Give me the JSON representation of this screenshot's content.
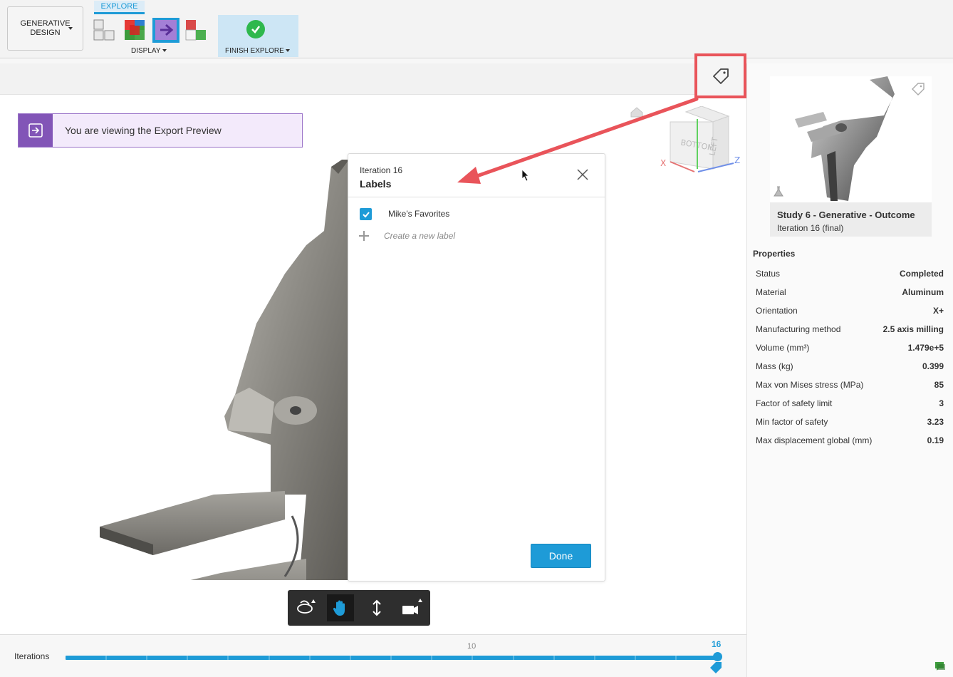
{
  "toolbar": {
    "workspace_label": "GENERATIVE DESIGN",
    "active_tab": "EXPLORE",
    "display_label": "DISPLAY",
    "finish_label": "FINISH EXPLORE",
    "icons": [
      "display-grid-icon",
      "display-heatmap-icon",
      "export-preview-icon",
      "compare-icon"
    ]
  },
  "banner": {
    "text": "You are viewing the Export Preview"
  },
  "viewcube": {
    "faces": [
      "BOTTOM",
      "LEFT"
    ],
    "axes": [
      "X",
      "Z"
    ]
  },
  "dialog": {
    "subtitle": "Iteration 16",
    "title": "Labels",
    "labels": [
      {
        "name": "Mike's Favorites",
        "checked": true
      }
    ],
    "new_label_placeholder": "Create a new label",
    "done_label": "Done"
  },
  "iterations": {
    "label": "Iterations",
    "tick_label": "10",
    "current": "16",
    "accent": "#1e9bd7"
  },
  "panel": {
    "card_title": "Study 6 - Generative - Outcome",
    "card_sub": "Iteration 16 (final)",
    "properties_title": "Properties",
    "properties": [
      {
        "name": "Status",
        "value": "Completed"
      },
      {
        "name": "Material",
        "value": "Aluminum"
      },
      {
        "name": "Orientation",
        "value": "X+"
      },
      {
        "name": "Manufacturing method",
        "value": "2.5 axis milling"
      },
      {
        "name": "Volume (mm³)",
        "value": "1.479e+5"
      },
      {
        "name": "Mass (kg)",
        "value": "0.399"
      },
      {
        "name": "Max von Mises stress (MPa)",
        "value": "85"
      },
      {
        "name": "Factor of safety limit",
        "value": "3"
      },
      {
        "name": "Min factor of safety",
        "value": "3.23"
      },
      {
        "name": "Max displacement global (mm)",
        "value": "0.19"
      }
    ]
  },
  "colors": {
    "accent": "#1e9bd7",
    "annotation": "#e9545a",
    "banner": "#8255b7",
    "finish": "#2eb84d"
  }
}
